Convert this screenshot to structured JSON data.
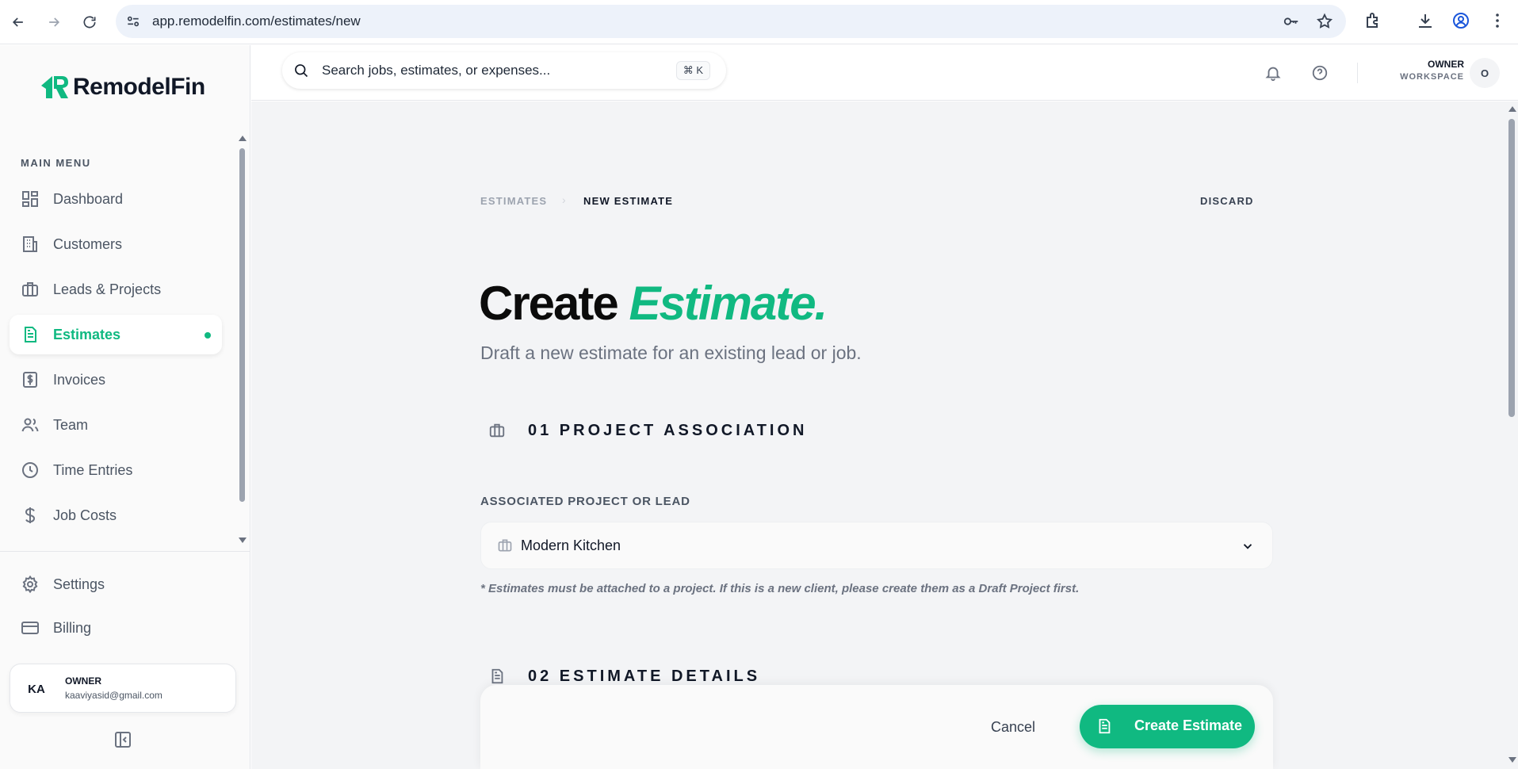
{
  "browser": {
    "url": "app.remodelfin.com/estimates/new"
  },
  "sidebar": {
    "brand": "RemodelFin",
    "menu_heading": "MAIN MENU",
    "items": [
      {
        "label": "Dashboard",
        "icon": "dashboard-icon"
      },
      {
        "label": "Customers",
        "icon": "building-icon"
      },
      {
        "label": "Leads & Projects",
        "icon": "briefcase-icon"
      },
      {
        "label": "Estimates",
        "icon": "document-icon",
        "active": true
      },
      {
        "label": "Invoices",
        "icon": "dollar-document-icon"
      },
      {
        "label": "Team",
        "icon": "users-icon"
      },
      {
        "label": "Time Entries",
        "icon": "clock-icon"
      },
      {
        "label": "Job Costs",
        "icon": "dollar-icon"
      }
    ],
    "bottom_items": [
      {
        "label": "Settings",
        "icon": "gear-icon"
      },
      {
        "label": "Billing",
        "icon": "credit-card-icon"
      }
    ],
    "user": {
      "initials": "KA",
      "role": "OWNER",
      "email": "kaaviyasid@gmail.com"
    }
  },
  "topbar": {
    "search_placeholder": "Search jobs, estimates, or expenses...",
    "shortcut": "⌘ K",
    "workspace_role": "OWNER",
    "workspace_label": "WORKSPACE",
    "workspace_initial": "O"
  },
  "main": {
    "breadcrumb": {
      "parent": "ESTIMATES",
      "separator": "›",
      "current": "NEW ESTIMATE"
    },
    "discard_label": "DISCARD",
    "title_plain": "Create",
    "title_accent": "Estimate.",
    "subtitle": "Draft a new estimate for an existing lead or job.",
    "sections": [
      {
        "title": "01 PROJECT ASSOCIATION"
      },
      {
        "title": "02 ESTIMATE DETAILS"
      }
    ],
    "project_field": {
      "label": "ASSOCIATED PROJECT OR LEAD",
      "value": "Modern Kitchen",
      "note": "* Estimates must be attached to a project. If this is a new client, please create them as a Draft Project first."
    },
    "actions": {
      "cancel_label": "Cancel",
      "create_label": "Create Estimate"
    }
  },
  "colors": {
    "accent": "#10b981",
    "text_dark": "#111827",
    "muted": "#6b7280"
  }
}
